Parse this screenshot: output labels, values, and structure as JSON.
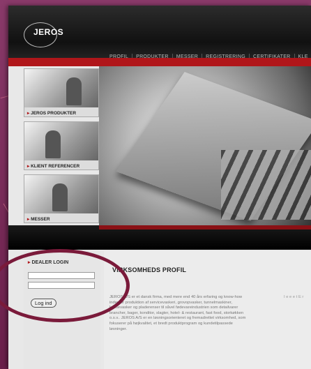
{
  "header": {
    "logo_text": "JEROS",
    "nav": [
      "PROFIL",
      "PRODUKTER",
      "MESSER",
      "REGISTRERING",
      "CERTIFIKATER",
      "KLE"
    ]
  },
  "sidebar": {
    "items": [
      {
        "label": "JEROS PRODUKTER"
      },
      {
        "label": "KLIENT REFERENCER"
      },
      {
        "label": "MESSER"
      }
    ]
  },
  "login": {
    "title": "DEALER LOGIN",
    "button": "Log ind"
  },
  "content": {
    "heading": "VIRKSOMHEDS PROFIL",
    "body": "JEROS A/S er et dansk firma, med mere end 40 års erfaring og know-how indenfor produktion af servicevaskeri, grovopvasker, tunnelmaskiner, kassevasker og pladerenser til såvel fødevareindustrien som detailvarer brancher, bager, konditor, slagter, hotel- & restaurant, fast food, storkøkken o.s.v.. JEROS A/S er en løsningsorienteret og fremadrettet virksomhed, som fokuserer på højkvalitet, et bredt produktprogram og kundetilpassede løsninger.",
    "side_text": "I e e e t E r"
  }
}
